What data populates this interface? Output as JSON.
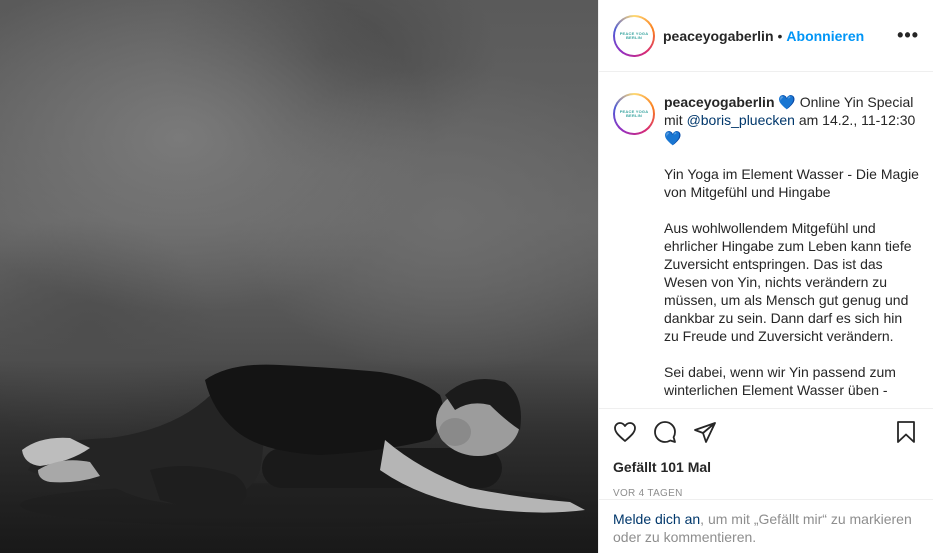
{
  "post": {
    "username": "peaceyogaberlin",
    "separator": "•",
    "follow_label": "Abonnieren",
    "more_label": "•••",
    "avatar_logo_lines": [
      "PEACE YOGA",
      "BERLIN"
    ]
  },
  "caption": {
    "username": "peaceyogaberlin",
    "heart": "💙",
    "intro_text": " Online Yin Special mit ",
    "mention": "@boris_pluecken",
    "intro_tail": " am 14.2., 11-12:30 ",
    "paragraphs": [
      "Yin Yoga im Element Wasser - Die Magie von Mitgefühl und Hingabe",
      "Aus wohlwollendem Mitgefühl und ehrlicher Hingabe zum Leben kann tiefe Zuversicht entspringen. Das ist das Wesen von Yin, nichts verändern zu müssen, um als Mensch gut genug und dankbar zu sein. Dann darf es sich hin zu Freude und Zuversicht verändern.",
      "Sei dabei, wenn wir Yin passend zum winterlichen Element Wasser üben -"
    ]
  },
  "actions": {
    "icons": [
      "heart-icon",
      "comment-icon",
      "share-icon",
      "bookmark-icon"
    ],
    "likes": "Gefällt 101 Mal",
    "age": "VOR 4 TAGEN"
  },
  "login": {
    "link": "Melde dich an",
    "text": ", um mit „Gefällt mir“ zu markieren oder zu kommentieren."
  },
  "colors": {
    "accent": "#0095f6",
    "link": "#00376b",
    "muted": "#8e8e8e",
    "heart": "#1a63e8"
  }
}
